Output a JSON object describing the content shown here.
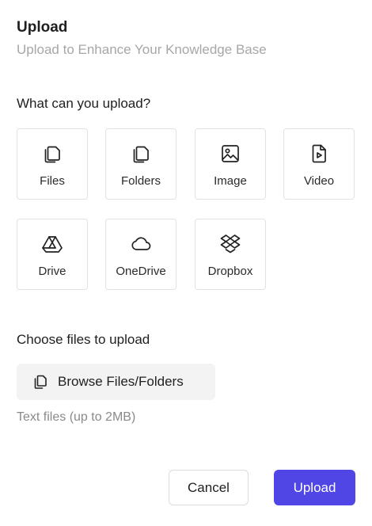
{
  "dialog": {
    "title": "Upload",
    "subtitle": "Upload to Enhance Your Knowledge Base"
  },
  "sources": {
    "heading": "What can you upload?",
    "items": [
      {
        "label": "Files",
        "icon": "files-icon"
      },
      {
        "label": "Folders",
        "icon": "folders-icon"
      },
      {
        "label": "Image",
        "icon": "image-icon"
      },
      {
        "label": "Video",
        "icon": "video-file-icon"
      },
      {
        "label": "Drive",
        "icon": "google-drive-icon"
      },
      {
        "label": "OneDrive",
        "icon": "cloud-icon"
      },
      {
        "label": "Dropbox",
        "icon": "dropbox-icon"
      }
    ]
  },
  "choose": {
    "heading": "Choose files to upload",
    "browse_label": "Browse Files/Folders",
    "browse_icon": "copy-files-icon",
    "hint": "Text files (up to 2MB)"
  },
  "footer": {
    "cancel_label": "Cancel",
    "upload_label": "Upload"
  },
  "colors": {
    "primary": "#4f46e5",
    "subtitle": "#a7a7a7",
    "hint": "#8a8a8a",
    "tile_border": "#e2e2e2",
    "browse_bg": "#f3f3f3"
  }
}
